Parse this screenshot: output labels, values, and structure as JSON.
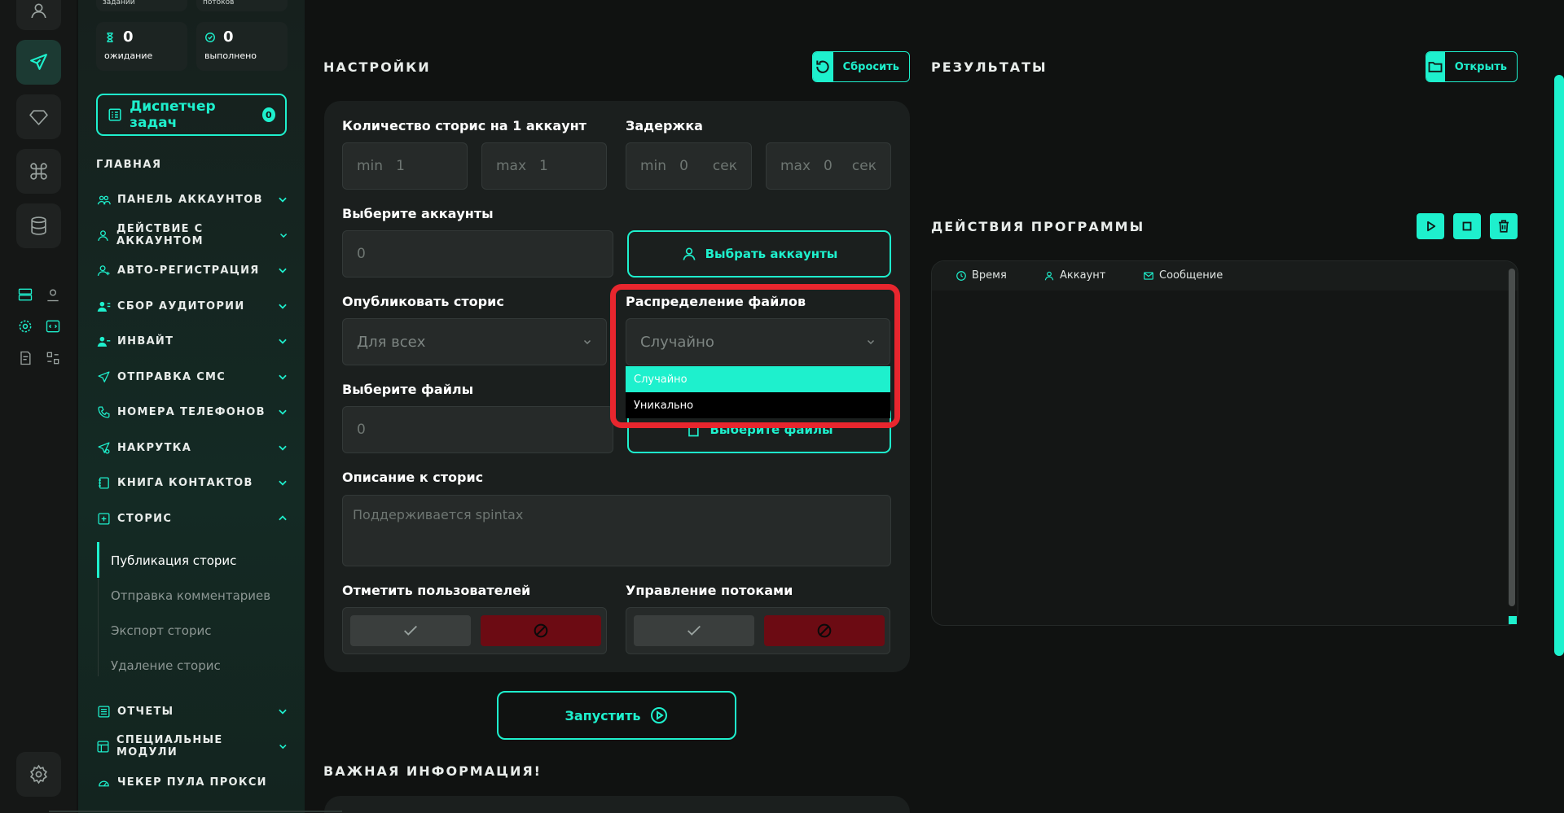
{
  "sidebar": {
    "stats_top": [
      {
        "label": "заданий"
      },
      {
        "label": "потоков"
      }
    ],
    "stats": [
      {
        "value": "0",
        "label": "ожидание",
        "icon": "hourglass-icon"
      },
      {
        "value": "0",
        "label": "выполнено",
        "icon": "check-circle-icon"
      }
    ],
    "dispatcher": {
      "label": "Диспетчер задач",
      "badge": "0"
    },
    "section_title": "ГЛАВНАЯ",
    "items": [
      {
        "label": "ПАНЕЛЬ АККАУНТОВ"
      },
      {
        "label": "ДЕЙСТВИЕ С АККАУНТОМ"
      },
      {
        "label": "АВТО-РЕГИСТРАЦИЯ"
      },
      {
        "label": "СБОР АУДИТОРИИ"
      },
      {
        "label": "ИНВАЙТ"
      },
      {
        "label": "ОТПРАВКА СМС"
      },
      {
        "label": "НОМЕРА ТЕЛЕФОНОВ"
      },
      {
        "label": "НАКРУТКА"
      },
      {
        "label": "КНИГА КОНТАКТОВ"
      },
      {
        "label": "СТОРИС"
      },
      {
        "label": "ОТЧЕТЫ"
      },
      {
        "label": "СПЕЦИАЛЬНЫЕ МОДУЛИ"
      },
      {
        "label": "ЧЕКЕР ПУЛА ПРОКСИ"
      }
    ],
    "stories_sub": [
      {
        "label": "Публикация сторис",
        "active": true
      },
      {
        "label": "Отправка комментариев"
      },
      {
        "label": "Экспорт сторис"
      },
      {
        "label": "Удаление сторис"
      }
    ]
  },
  "settings": {
    "title": "НАСТРОЙКИ",
    "reset_label": "Сбросить",
    "stories_count": {
      "label": "Количество сторис на 1 аккаунт",
      "min_prefix": "min",
      "min_value": "1",
      "max_prefix": "max",
      "max_value": "1"
    },
    "delay": {
      "label": "Задержка",
      "min_prefix": "min",
      "min_value": "0",
      "max_prefix": "max",
      "max_value": "0",
      "unit": "сек"
    },
    "accounts": {
      "label": "Выберите аккаунты",
      "value": "0",
      "button": "Выбрать аккаунты"
    },
    "publish": {
      "label": "Опубликовать сторис",
      "value": "Для всех"
    },
    "distribution": {
      "label": "Распределение файлов",
      "value": "Случайно",
      "options": [
        "Случайно",
        "Уникально"
      ],
      "selected_index": 0
    },
    "files": {
      "label": "Выберите файлы",
      "value": "0",
      "button": "Выберите файлы"
    },
    "description": {
      "label": "Описание к сторис",
      "placeholder": "Поддерживается spintax"
    },
    "mark_users": {
      "label": "Отметить пользователей"
    },
    "threads": {
      "label": "Управление потоками"
    },
    "run_label": "Запустить"
  },
  "important_title": "ВАЖНАЯ ИНФОРМАЦИЯ!",
  "results": {
    "title": "РЕЗУЛЬТАТЫ",
    "open_label": "Открыть"
  },
  "actions": {
    "title": "ДЕЙСТВИЯ ПРОГРАММЫ",
    "columns": [
      {
        "label": "Время",
        "icon": "clock-icon"
      },
      {
        "label": "Аккаунт",
        "icon": "user-icon"
      },
      {
        "label": "Сообщение",
        "icon": "mail-icon"
      }
    ]
  },
  "colors": {
    "accent": "#1ef0cd",
    "danger": "#6c0b13",
    "highlight": "#e8262e"
  }
}
